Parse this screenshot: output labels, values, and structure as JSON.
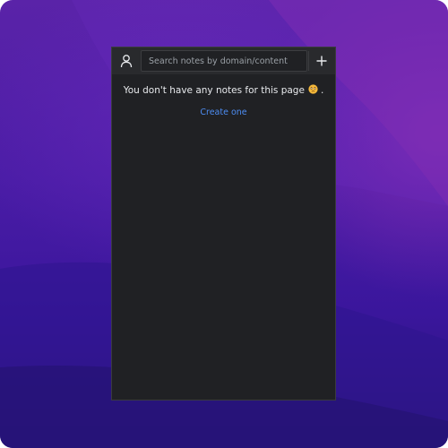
{
  "search": {
    "placeholder": "Search notes by domain/content",
    "value": ""
  },
  "icons": {
    "user": "user-icon",
    "add": "plus-icon",
    "emoji": "worried-face-icon"
  },
  "empty_state": {
    "message": "You don't have any notes for this page",
    "trailing": ".",
    "link_label": "Create one"
  },
  "colors": {
    "panel_bg": "#202124",
    "topbar_bg": "#292a2d",
    "text": "#e8eaed",
    "link": "#4d8df3",
    "wallpaper_top": "#5a23a8",
    "wallpaper_bottom": "#2a1478"
  }
}
